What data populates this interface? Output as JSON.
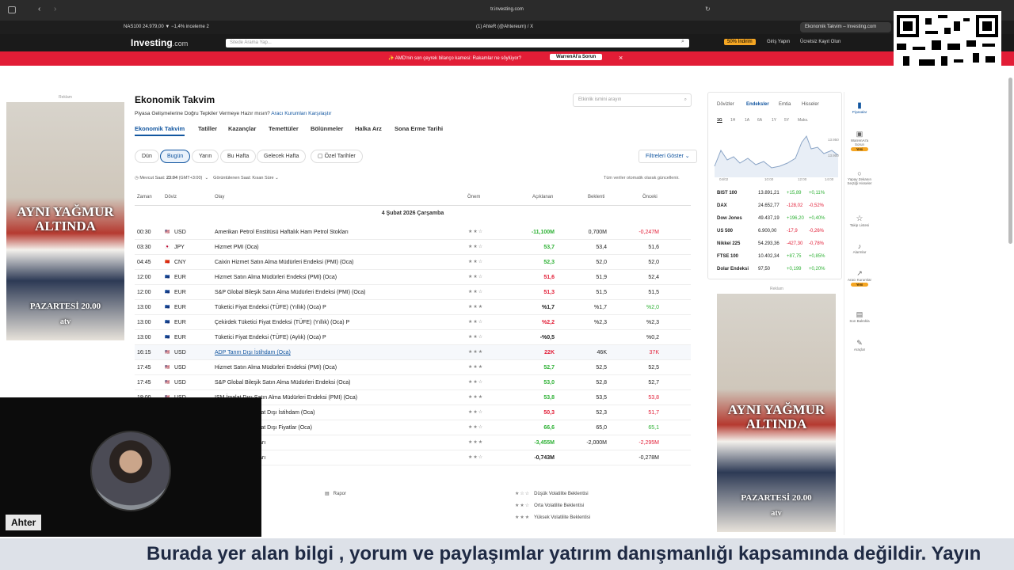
{
  "browser": {
    "url": "tr.investing.com",
    "tabs": [
      "NAS100 24.979,00 ▼ −1,4% inceleme 2",
      "(1) AhteR (@Ahtereum) / X",
      "Ekonomik Takvim – Investing.com"
    ]
  },
  "site": {
    "logo": "Investing",
    "logo_suffix": ".com",
    "search_placeholder": "Sitede Arama Yap...",
    "discount": "50% İndirim",
    "login": "Giriş Yapın",
    "signup": "Ücretsiz Kayıt Olun"
  },
  "promo": {
    "text": "✨ AMD'nin son çeyrek bilanço kamesi: Rakamlar ne söylüyor?",
    "button": "WarrenAI'a Sorun",
    "close": "×"
  },
  "ad": {
    "label": "Reklam",
    "title": "AYNI YAĞMUR ALTINDA",
    "date": "PAZARTESİ 20.00",
    "channel": "atv"
  },
  "page": {
    "title": "Ekonomik Takvim",
    "subtitle": "Piyasa Gelişmelerine Doğru Tepkiler Vermeye Hazır mısın?",
    "subtitle_link": "Aracı Kurumları Karşılaştır",
    "search_placeholder": "Etkinlik ismini arayın",
    "tabs": [
      "Ekonomik Takvim",
      "Tatiller",
      "Kazançlar",
      "Temettüler",
      "Bölünmeler",
      "Halka Arz",
      "Sona Erme Tarihi"
    ],
    "chips": [
      "Dün",
      "Bugün",
      "Yarın",
      "Bu Hafta",
      "Gelecek Hafta",
      "Özel Tarihler"
    ],
    "filter_button": "Filtreleri Göster",
    "current_time_label": "Mevcut Saat:",
    "current_time": "23:04",
    "tz": "(GMT+3:00)",
    "display_time": "Görüntülenen Saat: Kısan Süre",
    "auto_update": "Tüm veriler otomatik olarak güncellenir.",
    "columns": [
      "Zaman",
      "Döviz",
      "Olay",
      "Önem",
      "Açıklanan",
      "Beklenti",
      "Önceki"
    ],
    "date_row": "4 Şubat 2026 Çarşamba",
    "rows": [
      {
        "time": "00:30",
        "flag": "🇺🇸",
        "cur": "USD",
        "event": "Amerikan Petrol Enstitüsü Haftalık Ham Petrol Stokları",
        "imp": "★★☆",
        "actual": "-11,100M",
        "ac": "green",
        "forecast": "0,700M",
        "prev": "-0,247M",
        "pc": "red"
      },
      {
        "time": "03:30",
        "flag": "🇯🇵",
        "cur": "JPY",
        "event": "Hizmet PMI  (Oca)",
        "imp": "★★☆",
        "actual": "53,7",
        "ac": "green",
        "forecast": "53,4",
        "prev": "51,6",
        "pc": ""
      },
      {
        "time": "04:45",
        "flag": "🇨🇳",
        "cur": "CNY",
        "event": "Caixin Hizmet Satın Alma Müdürleri Endeksi (PMI)  (Oca)",
        "imp": "★★☆",
        "actual": "52,3",
        "ac": "green",
        "forecast": "52,0",
        "prev": "52,0",
        "pc": ""
      },
      {
        "time": "12:00",
        "flag": "🇪🇺",
        "cur": "EUR",
        "event": "Hizmet Satın Alma Müdürleri Endeksi (PMI)  (Oca)",
        "imp": "★★☆",
        "actual": "51,6",
        "ac": "red",
        "forecast": "51,9",
        "prev": "52,4",
        "pc": ""
      },
      {
        "time": "12:00",
        "flag": "🇪🇺",
        "cur": "EUR",
        "event": "S&P Global Bileşik Satın Alma Müdürleri Endeksi (PMI)  (Oca)",
        "imp": "★★☆",
        "actual": "51,3",
        "ac": "red",
        "forecast": "51,5",
        "prev": "51,5",
        "pc": ""
      },
      {
        "time": "13:00",
        "flag": "🇪🇺",
        "cur": "EUR",
        "event": "Tüketici Fiyat Endeksi (TÜFE) (Yıllık) (Oca)   P",
        "imp": "★★★",
        "actual": "%1,7",
        "ac": "",
        "forecast": "%1,7",
        "prev": "%2,0",
        "pc": "green"
      },
      {
        "time": "13:00",
        "flag": "🇪🇺",
        "cur": "EUR",
        "event": "Çekirdek Tüketici Fiyat Endeksi (TÜFE) (Yıllık) (Oca)   P",
        "imp": "★★☆",
        "actual": "%2,2",
        "ac": "red",
        "forecast": "%2,3",
        "prev": "%2,3",
        "pc": ""
      },
      {
        "time": "13:00",
        "flag": "🇪🇺",
        "cur": "EUR",
        "event": "Tüketici Fiyat Endeksi (TÜFE) (Aylık) (Oca)   P",
        "imp": "★★☆",
        "actual": "-%0,5",
        "ac": "",
        "forecast": "",
        "prev": "%0,2",
        "pc": ""
      },
      {
        "time": "16:15",
        "flag": "🇺🇸",
        "cur": "USD",
        "event": "ADP Tarım Dışı İstihdam  (Oca)",
        "imp": "★★★",
        "actual": "22K",
        "ac": "red",
        "forecast": "46K",
        "prev": "37K",
        "pc": "red"
      },
      {
        "time": "17:45",
        "flag": "🇺🇸",
        "cur": "USD",
        "event": "Hizmet Satın Alma Müdürleri Endeksi (PMI)  (Oca)",
        "imp": "★★★",
        "actual": "52,7",
        "ac": "green",
        "forecast": "52,5",
        "prev": "52,5",
        "pc": ""
      },
      {
        "time": "17:45",
        "flag": "🇺🇸",
        "cur": "USD",
        "event": "S&P Global Bileşik Satın Alma Müdürleri Endeksi (Oca)",
        "imp": "★★☆",
        "actual": "53,0",
        "ac": "green",
        "forecast": "52,8",
        "prev": "52,7",
        "pc": ""
      },
      {
        "time": "18:00",
        "flag": "🇺🇸",
        "cur": "USD",
        "event": "ISM İmalat Dışı Satın Alma Müdürleri Endeksi (PMI)  (Oca)",
        "imp": "★★★",
        "actual": "53,8",
        "ac": "green",
        "forecast": "53,5",
        "prev": "53,8",
        "pc": "red"
      },
      {
        "time": "",
        "flag": "",
        "cur": "",
        "event": "nstitüsü (ISM) İmalat Dışı İstihdam  (Oca)",
        "imp": "★★☆",
        "actual": "50,3",
        "ac": "red",
        "forecast": "52,3",
        "prev": "51,7",
        "pc": "red"
      },
      {
        "time": "",
        "flag": "",
        "cur": "",
        "event": "nstitüsü (ISM) İmalat Dışı Fiyatlar  (Oca)",
        "imp": "★★☆",
        "actual": "66,6",
        "ac": "green",
        "forecast": "65,0",
        "prev": "65,1",
        "pc": "green"
      },
      {
        "time": "",
        "flag": "",
        "cur": "",
        "event": "i Ham Petrol Stokları",
        "imp": "★★★",
        "actual": "-3,455M",
        "ac": "green",
        "forecast": "-2,000M",
        "prev": "-2,295M",
        "pc": "red"
      },
      {
        "time": "",
        "flag": "",
        "cur": "",
        "event": "i Ham Petrol Stokları",
        "imp": "★★☆",
        "actual": "-0,743M",
        "ac": "",
        "forecast": "",
        "prev": "-0,278M",
        "pc": ""
      }
    ],
    "legend": [
      {
        "stars": "★☆☆",
        "label": "Düşük Volatilite Beklentisi"
      },
      {
        "stars": "★★☆",
        "label": "Orta Volatilite Beklentisi"
      },
      {
        "stars": "★★★",
        "label": "Yüksek Volatilite Beklentisi"
      }
    ],
    "legend_report": "Rapor"
  },
  "markets": {
    "tabs": [
      "Dövizler",
      "Endeksler",
      "Emtia",
      "Hisseler"
    ],
    "ranges": [
      "1G",
      "1H",
      "1A",
      "6A",
      "1Y",
      "5Y",
      "Maks."
    ],
    "chart_labels": [
      "04/02",
      "10:00",
      "12:00",
      "14:00"
    ],
    "chart_y": [
      "13.950",
      "13.900"
    ],
    "rows": [
      {
        "name": "BIST 100",
        "last": "13.891,21",
        "chg": "+15,89",
        "pct": "+0,11%",
        "c": "green"
      },
      {
        "name": "DAX",
        "last": "24.652,77",
        "chg": "-128,02",
        "pct": "-0,52%",
        "c": "red"
      },
      {
        "name": "Dow Jones",
        "last": "49.437,19",
        "chg": "+196,20",
        "pct": "+0,40%",
        "c": "green"
      },
      {
        "name": "US 500",
        "last": "6.900,00",
        "chg": "-17,9",
        "pct": "-0,26%",
        "c": "red"
      },
      {
        "name": "Nikkei 225",
        "last": "54.293,36",
        "chg": "-427,30",
        "pct": "-0,78%",
        "c": "red"
      },
      {
        "name": "FTSE 100",
        "last": "10.402,34",
        "chg": "+87,75",
        "pct": "+0,85%",
        "c": "green"
      },
      {
        "name": "Dolar Endeksi",
        "last": "97,50",
        "chg": "+0,199",
        "pct": "+0,20%",
        "c": "green"
      }
    ]
  },
  "sidebar": {
    "items": [
      "Piyasalar",
      "WarrenAI'a Sorun",
      "Yapay Zekanın Seçtiği Hisseler",
      "Takip Listesi",
      "Alarmlar",
      "Aracı Kurumlar",
      "Son Baktıkla",
      "Araçlar"
    ],
    "badge": "Yeni"
  },
  "streamer": {
    "name": "Ahter"
  },
  "subtitle": "Burada yer alan bilgi , yorum ve paylaşımlar yatırım danışmanlığı kapsamında değildir. Yayın"
}
